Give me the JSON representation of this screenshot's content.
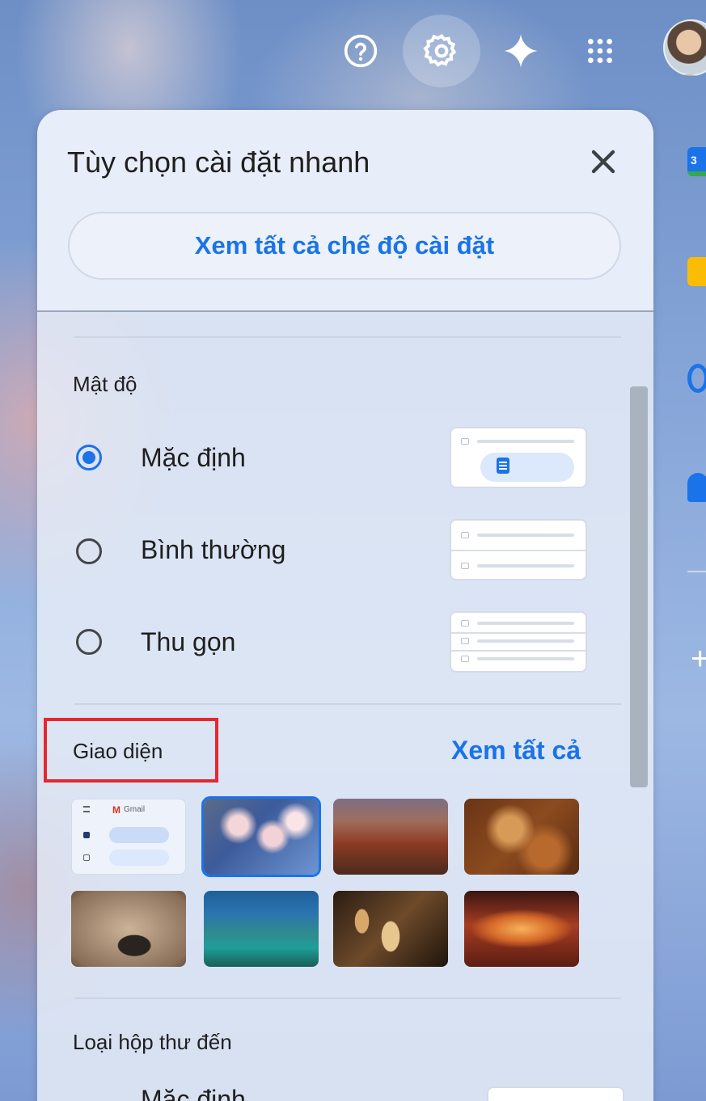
{
  "topbar": {
    "help_icon": "help-circle-icon",
    "settings_icon": "gear-icon",
    "gemini_icon": "sparkle-icon",
    "apps_icon": "apps-grid-icon"
  },
  "side_panel": {
    "calendar_badge": "3"
  },
  "quick_settings": {
    "title": "Tùy chọn cài đặt nhanh",
    "see_all_settings": "Xem tất cả chế độ cài đặt",
    "density": {
      "title": "Mật độ",
      "options": [
        {
          "label": "Mặc định",
          "selected": true
        },
        {
          "label": "Bình thường",
          "selected": false
        },
        {
          "label": "Thu gọn",
          "selected": false
        }
      ]
    },
    "themes": {
      "title": "Giao diện",
      "see_all": "Xem tất cả",
      "thumbnail_text": "Gmail",
      "items": [
        "default",
        "cherry-blossom",
        "canyon",
        "autumn-leaves",
        "sand-stone",
        "lake-city",
        "chess",
        "antelope-canyon"
      ],
      "selected": "cherry-blossom"
    },
    "inbox_type": {
      "title": "Loại hộp thư đến",
      "first_option": "Mặc định"
    }
  },
  "colors": {
    "accent": "#1a73e8",
    "highlight_box": "#e8262e"
  }
}
